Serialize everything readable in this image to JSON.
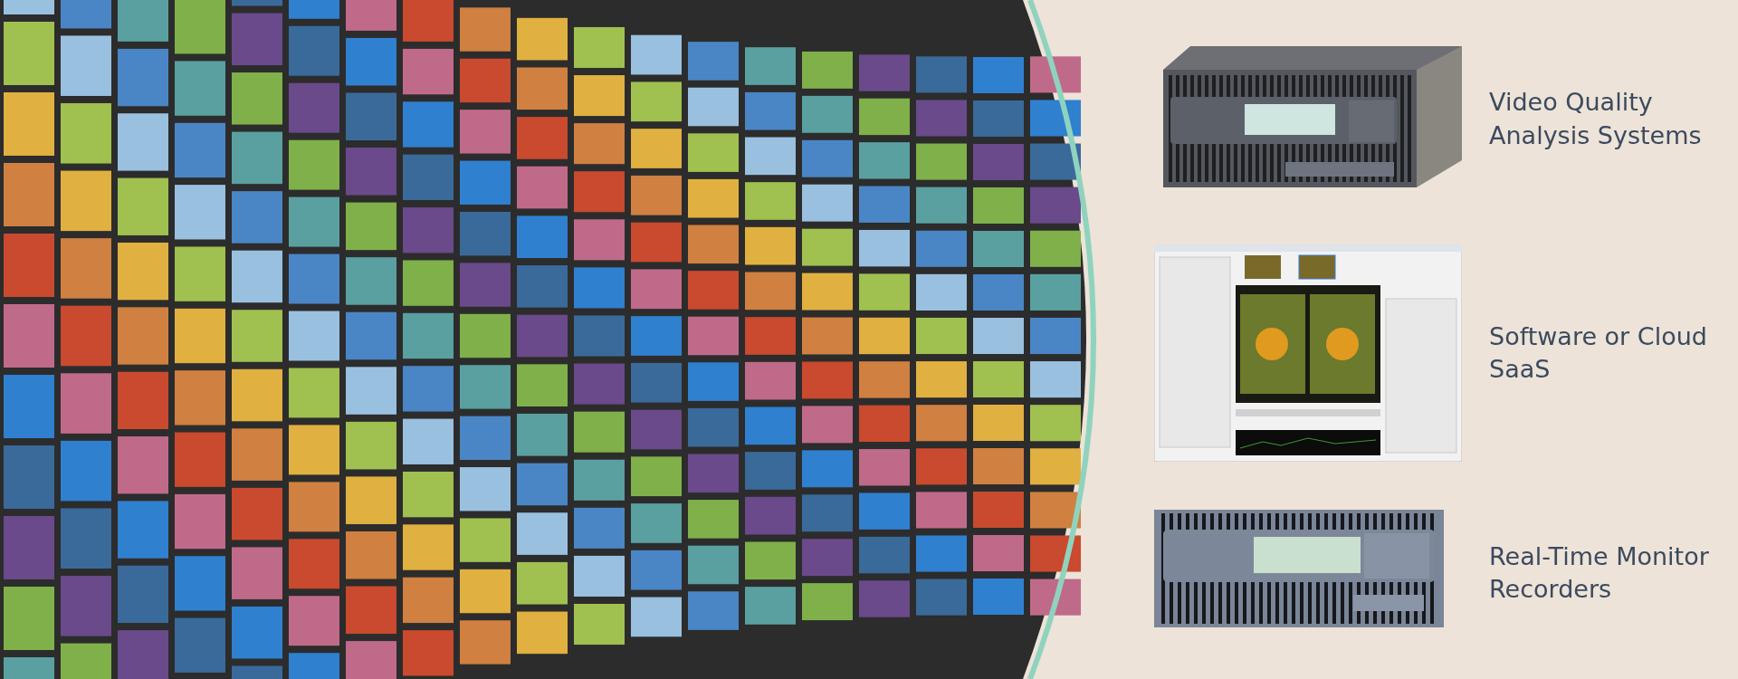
{
  "products": [
    {
      "kind": "rack-unit",
      "lines": [
        "Video Quality",
        "Analysis Systems"
      ]
    },
    {
      "kind": "software",
      "lines": [
        "Software or Cloud",
        "SaaS"
      ]
    },
    {
      "kind": "front-panel",
      "lines": [
        "Real-Time Monitor",
        "Recorders"
      ]
    }
  ]
}
